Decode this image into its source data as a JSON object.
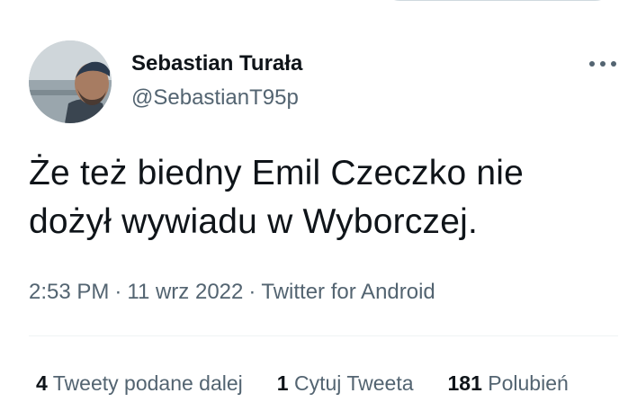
{
  "author": {
    "name": "Sebastian Turała",
    "handle": "@SebastianT95p"
  },
  "more_icon": "ellipsis-icon",
  "tweet": {
    "text": "Że też biedny Emil Czeczko nie dożył wywiadu w Wyborczej."
  },
  "meta": {
    "time": "2:53 PM",
    "date": "11 wrz 2022",
    "source": "Twitter for Android",
    "separator": "·"
  },
  "stats": {
    "retweets_count": "4",
    "retweets_label": "Tweety podane dalej",
    "quotes_count": "1",
    "quotes_label": "Cytuj Tweeta",
    "likes_count": "181",
    "likes_label": "Polubień"
  },
  "colors": {
    "text": "#0f1419",
    "secondary": "#536471",
    "divider": "#eff3f4"
  }
}
